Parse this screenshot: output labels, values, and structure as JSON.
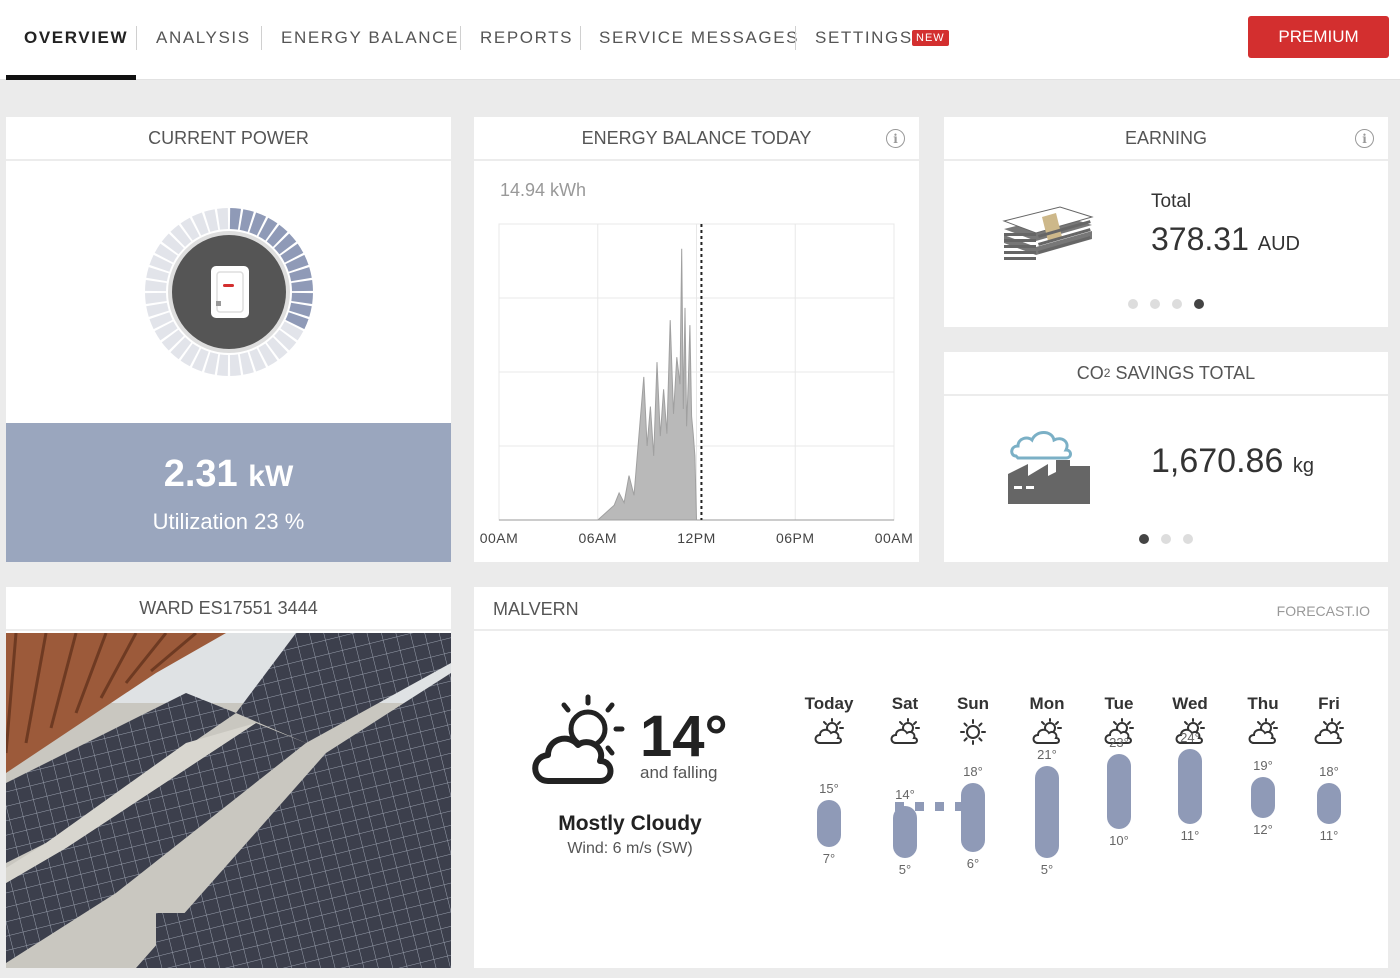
{
  "nav": {
    "tabs": [
      {
        "label": "OVERVIEW",
        "active": true
      },
      {
        "label": "ANALYSIS"
      },
      {
        "label": "ENERGY BALANCE"
      },
      {
        "label": "REPORTS"
      },
      {
        "label": "SERVICE MESSAGES"
      },
      {
        "label": "SETTINGS"
      }
    ],
    "settings_badge": "NEW",
    "premium_label": "PREMIUM",
    "accent_color": "#d32f2f"
  },
  "current_power": {
    "title": "CURRENT POWER",
    "value": "2.31",
    "unit": "kW",
    "utilization_label": "Utilization 23 %",
    "utilization_fraction": 0.23,
    "icon": "inverter-icon"
  },
  "energy_balance": {
    "title": "ENERGY BALANCE TODAY",
    "total": "14.94 kWh",
    "chart_data": {
      "type": "area",
      "x_ticks": [
        "00AM",
        "06AM",
        "12PM",
        "06PM",
        "00AM"
      ],
      "x_range_hours": [
        0,
        24
      ],
      "now_marker_hours": 12.3,
      "grid": true,
      "series": [
        {
          "x": [
            6.0,
            6.5,
            7.0,
            7.3,
            7.6,
            7.9,
            8.2,
            8.5,
            8.8,
            9.0,
            9.2,
            9.4,
            9.6,
            9.8,
            10.0,
            10.2,
            10.4,
            10.6,
            10.8,
            11.0,
            11.1,
            11.2,
            11.3,
            11.4,
            11.5,
            11.6,
            11.7,
            11.8,
            11.9,
            12.0
          ],
          "y": [
            0.0,
            0.3,
            0.6,
            1.1,
            0.7,
            1.8,
            1.0,
            3.4,
            5.8,
            3.0,
            4.6,
            2.6,
            6.4,
            3.4,
            5.3,
            3.5,
            8.1,
            4.3,
            6.6,
            5.5,
            11.0,
            4.5,
            8.6,
            3.8,
            5.6,
            7.9,
            4.2,
            3.5,
            2.6,
            0.0
          ]
        }
      ]
    }
  },
  "earning": {
    "title": "EARNING",
    "total_label": "Total",
    "value": "378.31",
    "unit": "AUD",
    "icon": "money-stack-icon",
    "dots": 4,
    "active_dot": 3
  },
  "co2": {
    "title_prefix": "CO",
    "title_sub": "2",
    "title_suffix": " SAVINGS TOTAL",
    "value": "1,670.86",
    "unit": "kg",
    "icon": "factory-icon",
    "dots": 3,
    "active_dot": 0
  },
  "site": {
    "title": "WARD ES17551 3444",
    "image": "solar-panels-photo"
  },
  "weather": {
    "city": "MALVERN",
    "source": "FORECAST.IO",
    "current_temp": "14°",
    "trend": "and falling",
    "condition": "Mostly Cloudy",
    "wind": "Wind: 6 m/s (SW)",
    "icon": "partly-cloudy-icon",
    "forecast": [
      {
        "day": "Today",
        "high": 15,
        "low": 7,
        "high_label": "15°",
        "low_label": "7°"
      },
      {
        "day": "Sat",
        "high": 14,
        "low": 5,
        "high_label": "14°",
        "low_label": "5°"
      },
      {
        "day": "Sun",
        "high": 18,
        "low": 6,
        "high_label": "18°",
        "low_label": "6°"
      },
      {
        "day": "Mon",
        "high": 21,
        "low": 5,
        "high_label": "21°",
        "low_label": "5°"
      },
      {
        "day": "Tue",
        "high": 23,
        "low": 10,
        "high_label": "23°",
        "low_label": "10°"
      },
      {
        "day": "Wed",
        "high": 24,
        "low": 11,
        "high_label": "24°",
        "low_label": "11°"
      },
      {
        "day": "Thu",
        "high": 19,
        "low": 12,
        "high_label": "19°",
        "low_label": "12°"
      },
      {
        "day": "Fri",
        "high": 18,
        "low": 11,
        "high_label": "18°",
        "low_label": "11°"
      }
    ]
  }
}
